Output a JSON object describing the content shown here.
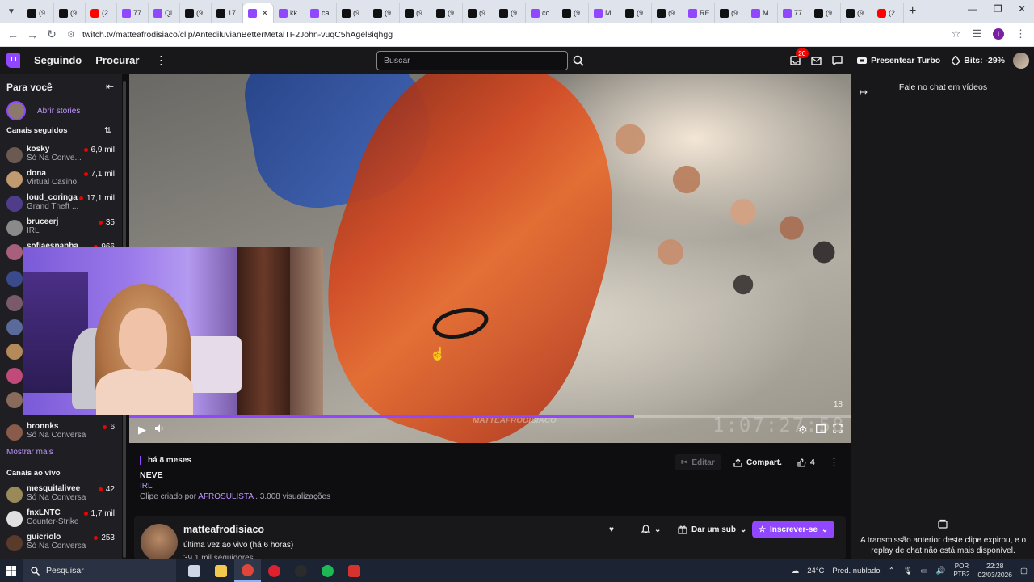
{
  "browser": {
    "tabs": [
      {
        "icon": "tiktok",
        "label": "(9"
      },
      {
        "icon": "tiktok",
        "label": "(9"
      },
      {
        "icon": "youtube",
        "label": "(2"
      },
      {
        "icon": "twitch",
        "label": "77"
      },
      {
        "icon": "twitch",
        "label": "Ql"
      },
      {
        "icon": "tiktok",
        "label": "(9"
      },
      {
        "icon": "tiktok",
        "label": "17"
      },
      {
        "icon": "twitch",
        "label": "",
        "active": true
      },
      {
        "icon": "twitch",
        "label": "kk"
      },
      {
        "icon": "twitch",
        "label": "ca"
      },
      {
        "icon": "tiktok",
        "label": "(9"
      },
      {
        "icon": "tiktok",
        "label": "(9"
      },
      {
        "icon": "tiktok",
        "label": "(9"
      },
      {
        "icon": "tiktok",
        "label": "(9"
      },
      {
        "icon": "tiktok",
        "label": "(9"
      },
      {
        "icon": "tiktok",
        "label": "(9"
      },
      {
        "icon": "twitch",
        "label": "cc"
      },
      {
        "icon": "tiktok",
        "label": "(9"
      },
      {
        "icon": "twitch",
        "label": "M"
      },
      {
        "icon": "tiktok",
        "label": "(9"
      },
      {
        "icon": "tiktok",
        "label": "(9"
      },
      {
        "icon": "twitch",
        "label": "RE"
      },
      {
        "icon": "tiktok",
        "label": "(9"
      },
      {
        "icon": "twitch",
        "label": "M"
      },
      {
        "icon": "twitch",
        "label": "77"
      },
      {
        "icon": "tiktok",
        "label": "(9"
      },
      {
        "icon": "tiktok",
        "label": "(9"
      },
      {
        "icon": "youtube",
        "label": "(2"
      }
    ],
    "url": "twitch.tv/matteafrodisiaco/clip/AntediluvianBetterMetalTF2John-vuqC5hAgel8iqhgg",
    "profile_initial": "I"
  },
  "topnav": {
    "following": "Seguindo",
    "browse": "Procurar",
    "search_placeholder": "Buscar",
    "notif_count": "20",
    "turbo": "Presentear Turbo",
    "bits": "Bits: -29%"
  },
  "sidebar": {
    "header": "Para você",
    "stories": "Abrir stories",
    "followed_title": "Canais seguidos",
    "followed": [
      {
        "name": "kosky",
        "game": "Só Na Conve...",
        "viewers": "6,9 mil",
        "color": "#6a5a52"
      },
      {
        "name": "dona",
        "game": "Virtual Casino",
        "viewers": "7,1 mil",
        "color": "#c19a70"
      },
      {
        "name": "loud_coringa",
        "game": "Grand Theft ...",
        "viewers": "17,1 mil",
        "color": "#4f3d8a"
      },
      {
        "name": "bruceerj",
        "game": "IRL",
        "viewers": "35",
        "color": "#8a8a8a"
      },
      {
        "name": "sofiaespanha",
        "game": "",
        "viewers": "966",
        "color": "#a8607a"
      }
    ],
    "hidden_avatars": [
      "#3a4a8a",
      "#7a5a6a",
      "#5a6a9a",
      "#b58a5a",
      "#c04a7a",
      "#8a6a5a"
    ],
    "bottom_channel": {
      "name": "bronnks",
      "game": "Só Na Conversa",
      "viewers": "6",
      "color": "#8a5a4a"
    },
    "show_more": "Mostrar mais",
    "live_title": "Canais ao vivo",
    "live": [
      {
        "name": "mesquitalivee",
        "game": "Só Na Conversa",
        "viewers": "42",
        "color": "#9a8a5a"
      },
      {
        "name": "fnxLNTC",
        "game": "Counter-Strike",
        "viewers": "1,7 mil",
        "color": "#e0e0e0"
      },
      {
        "name": "guicriolo",
        "game": "Só Na Conversa",
        "viewers": "253",
        "color": "#5a3a2a"
      }
    ]
  },
  "player": {
    "timestamp_overlay": "1:07:27:58",
    "watermark": "MATTEAFRODISIACO",
    "corner_number": "18",
    "progress": 0.7
  },
  "clip": {
    "ago": "há 8 meses",
    "title": "NEVE",
    "category": "IRL",
    "created_by": "Clipe criado por",
    "creator": "AFROSULISTA",
    "views": ". 3.008 visualizações",
    "edit": "Editar",
    "share": "Compart.",
    "likes": "4"
  },
  "channel": {
    "name": "matteafrodisiaco",
    "last_live": "última vez ao vivo (há 6 horas)",
    "followers": "39,1 mil seguidores",
    "gift_sub": "Dar um sub",
    "subscribe": "Inscrever-se"
  },
  "chat": {
    "title": "Fale no chat em vídeos",
    "message": "A transmissão anterior deste clipe expirou, e o replay de chat não está mais disponível."
  },
  "taskbar": {
    "search": "Pesquisar",
    "apps": [
      "task-view",
      "file-explorer",
      "chrome",
      "opera",
      "app-circle",
      "spotify",
      "app-red"
    ],
    "weather_temp": "24°C",
    "weather_text": "Pred. nublado",
    "lang_1": "POR",
    "lang_2": "PTB2",
    "time": "22:28",
    "date": "02/03/2026"
  }
}
